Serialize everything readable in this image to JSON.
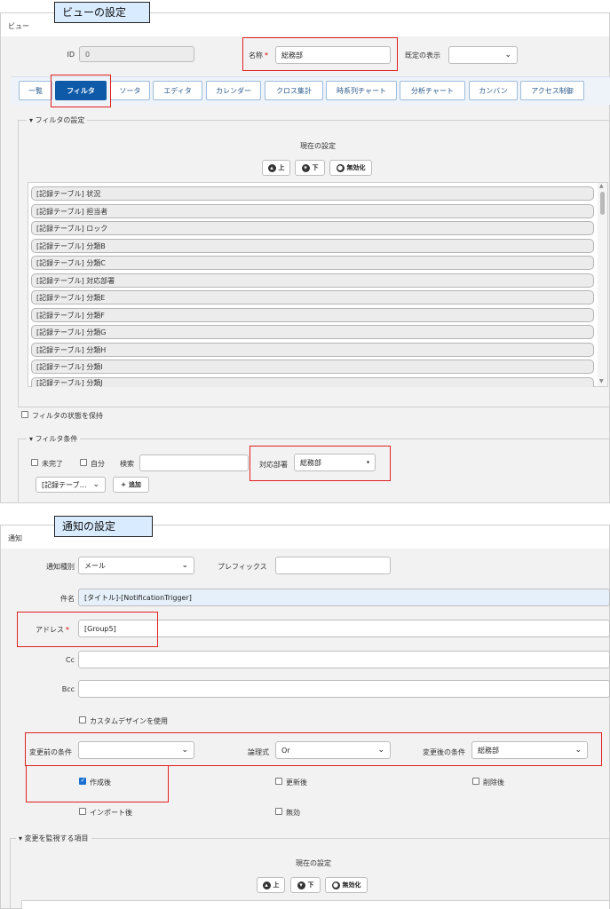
{
  "view": {
    "callout": "ビューの設定",
    "panel_title": "ビュー",
    "id_label": "ID",
    "id_value": "0",
    "name_label": "名称",
    "required_mark": "*",
    "name_value": "総務部",
    "default_display_label": "既定の表示",
    "default_display_value": "",
    "tabs": [
      {
        "label": "一覧"
      },
      {
        "label": "フィルタ"
      },
      {
        "label": "ソータ"
      },
      {
        "label": "エディタ"
      },
      {
        "label": "カレンダー"
      },
      {
        "label": "クロス集計"
      },
      {
        "label": "時系列チャート"
      },
      {
        "label": "分析チャート"
      },
      {
        "label": "カンバン"
      },
      {
        "label": "アクセス制御"
      }
    ],
    "active_tab": "フィルタ",
    "filter_settings_title": "フィルタの設定",
    "current_settings": "現在の設定",
    "btn_up": "上",
    "btn_down": "下",
    "btn_disable": "無効化",
    "list_items": [
      "[記録テーブル] 状況",
      "[記録テーブル] 担当者",
      "[記録テーブル] ロック",
      "[記録テーブル] 分類B",
      "[記録テーブル] 分類C",
      "[記録テーブル] 対応部署",
      "[記録テーブル] 分類E",
      "[記録テーブル] 分類F",
      "[記録テーブル] 分類G",
      "[記録テーブル] 分類H",
      "[記録テーブル] 分類I",
      "[記録テーブル] 分類J"
    ],
    "keep_filter_label": "フィルタの状態を保持",
    "filter_conditions_title": "フィルタ条件",
    "incomplete_label": "未完了",
    "self_label": "自分",
    "search_label": "検索",
    "dept_label": "対応部署",
    "dept_value": "総務部",
    "column_select_value": "[記録テーブ…",
    "add_button": "追加"
  },
  "notify": {
    "callout": "通知の設定",
    "panel_title": "通知",
    "type_label": "通知種別",
    "type_value": "メール",
    "prefix_label": "プレフィックス",
    "prefix_value": "",
    "subject_label": "件名",
    "subject_value": "[タイトル]-[NotificationTrigger]",
    "address_label": "アドレス",
    "address_value": "[Group5]",
    "cc_label": "Cc",
    "bcc_label": "Bcc",
    "custom_design_label": "カスタムデザインを使用",
    "before_cond_label": "変更前の条件",
    "before_cond_value": "",
    "logic_label": "論理式",
    "logic_value": "Or",
    "after_cond_label": "変更後の条件",
    "after_cond_value": "総務部",
    "created_label": "作成後",
    "updated_label": "更新後",
    "deleted_label": "削除後",
    "imported_label": "インポート後",
    "disabled_label": "無効",
    "monitor_title": "変更を監視する項目",
    "current_settings": "現在の設定",
    "btn_up": "上",
    "btn_down": "下",
    "btn_disable": "無効化"
  },
  "colors": {
    "accent": "#0e5aa8",
    "callout_bg": "#d9ecff",
    "highlight_border": "#e02020"
  }
}
